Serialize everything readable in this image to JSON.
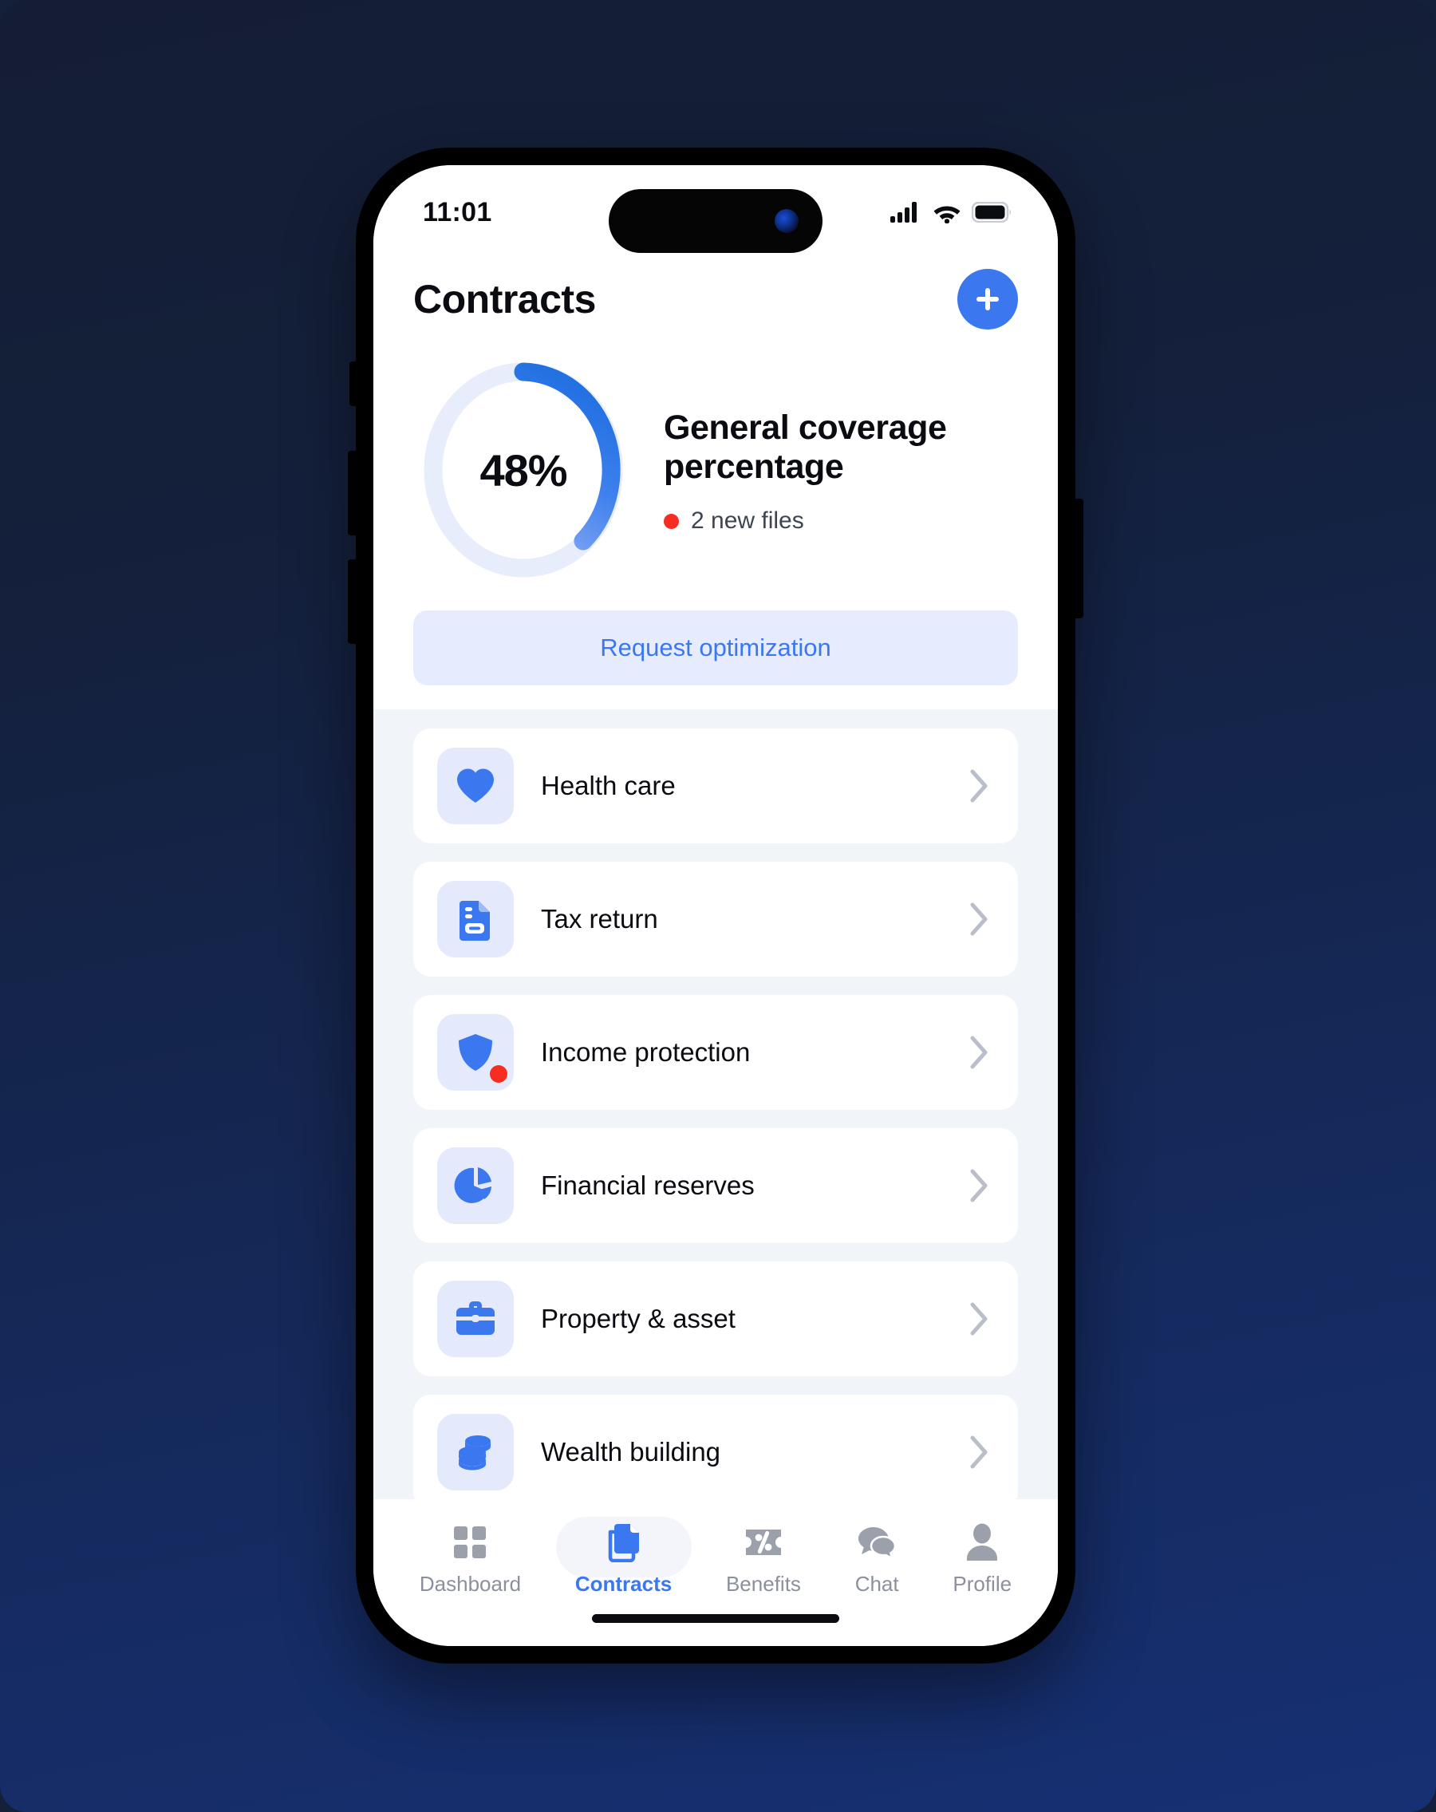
{
  "status_bar": {
    "time": "11:01",
    "icons": [
      "cellular-signal-icon",
      "wifi-icon",
      "battery-icon"
    ]
  },
  "header": {
    "title": "Contracts",
    "add_button_label": "+"
  },
  "coverage": {
    "percentage_label": "48%",
    "percentage_value": 48,
    "title": "General coverage percentage",
    "new_files_label": "2 new files",
    "dot_color": "#f62d20",
    "arc_start_color": "#1f6fe0",
    "arc_end_color": "#7ca2f2",
    "track_color": "#e8edfb"
  },
  "request_button": {
    "label": "Request optimization",
    "bg_color": "#e6ecfd",
    "text_color": "#3b78f0"
  },
  "contracts_list": [
    {
      "label": "Health care",
      "icon": "heart-icon",
      "badge": false
    },
    {
      "label": "Tax return",
      "icon": "document-icon",
      "badge": false
    },
    {
      "label": "Income protection",
      "icon": "shield-icon",
      "badge": true
    },
    {
      "label": "Financial reserves",
      "icon": "pie-chart-icon",
      "badge": false
    },
    {
      "label": "Property & asset",
      "icon": "briefcase-icon",
      "badge": false
    },
    {
      "label": "Wealth building",
      "icon": "coins-icon",
      "badge": false
    }
  ],
  "tab_bar": {
    "active_index": 1,
    "tabs": [
      {
        "label": "Dashboard",
        "icon": "grid-icon"
      },
      {
        "label": "Contracts",
        "icon": "document-stack-icon"
      },
      {
        "label": "Benefits",
        "icon": "ticket-percent-icon"
      },
      {
        "label": "Chat",
        "icon": "chat-bubbles-icon"
      },
      {
        "label": "Profile",
        "icon": "person-icon"
      }
    ]
  },
  "theme": {
    "accent": "#3b78f0",
    "page_bg_top": "#141d33",
    "page_bg_bottom": "#163073",
    "list_bg": "#f1f4f9"
  }
}
